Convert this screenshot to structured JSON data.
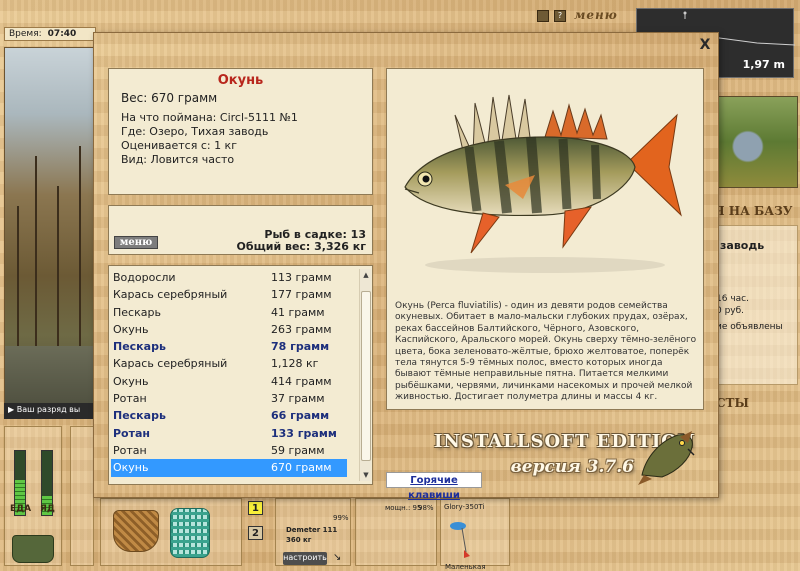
{
  "background": {
    "time_label": "Время:",
    "time_value": "07:40",
    "rank_text": "Ваш разряд вы",
    "gauge_left_label": "ЕДА",
    "gauge_right_label": "ЯД",
    "gauge_left_level": 0.55,
    "gauge_right_level": 0.3,
    "menu_word": "меню",
    "depth_value": "1,97 m",
    "to_base_text": "я на базу",
    "location_text": "заводь",
    "time_hours_text": "16 час.",
    "price_text": "0 руб.",
    "ads_text": "ие объявлены",
    "lower_text": "сты",
    "slot_numbers": [
      "1",
      "2"
    ],
    "percent_1": "99%",
    "reel_name": "Demeter 111",
    "reel_length": "360 кг",
    "setup_button": "настроить",
    "power_label": "мощн.: 95",
    "percent_2": "98%",
    "rod_name": "Glory-350Ti",
    "lure_name": "Маленькая"
  },
  "dialog": {
    "close_symbol": "X",
    "fish": {
      "name": "Окунь",
      "weight_line": "Вес: 670 грамм",
      "caught_on": "На что поймана: Circl-5111 №1",
      "where": "Где: Озеро, Тихая заводь",
      "rated_from": "Оценивается с: 1 кг",
      "kind": "Вид: Ловится часто",
      "description": "Окунь (Perca fluviatilis) - один из девяти родов семейства окуневых. Обитает в мало-мальски глубоких прудах, озёрах, реках бассейнов Балтийского, Чёрного, Азовского, Каспийского, Аральского морей. Окунь сверху тёмно-зелёного цвета, бока зеленовато-жёлтые, брюхо желтоватое, поперёк тела тянутся 5-9 тёмных полос, вместо которых иногда бывают тёмные неправильные пятна. Питается мелкими рыбёшками, червями, личинками насекомых и прочей мелкой живностью. Достигает полуметра длины и массы 4 кг."
    },
    "keepnet": {
      "menu_label": "меню",
      "count_line": "Рыб в садке: 13",
      "total_line": "Общий вес: 3,326 кг"
    },
    "catch_list": [
      {
        "name": "Водоросли",
        "weight": "113 грамм",
        "style": "normal"
      },
      {
        "name": "Карась серебряный",
        "weight": "177 грамм",
        "style": "normal"
      },
      {
        "name": "Пескарь",
        "weight": "41 грамм",
        "style": "normal"
      },
      {
        "name": "Окунь",
        "weight": "263 грамм",
        "style": "normal"
      },
      {
        "name": "Пескарь",
        "weight": "78 грамм",
        "style": "bold"
      },
      {
        "name": "Карась серебряный",
        "weight": "1,128 кг",
        "style": "normal"
      },
      {
        "name": "Окунь",
        "weight": "414 грамм",
        "style": "normal"
      },
      {
        "name": "Ротан",
        "weight": "37 грамм",
        "style": "normal"
      },
      {
        "name": "Пескарь",
        "weight": "66 грамм",
        "style": "bold"
      },
      {
        "name": "Ротан",
        "weight": "133 грамм",
        "style": "bold"
      },
      {
        "name": "Ротан",
        "weight": "59 грамм",
        "style": "normal"
      },
      {
        "name": "Окунь",
        "weight": "670 грамм",
        "style": "selected"
      }
    ],
    "brand": "INSTALLSOFT EDITION",
    "version": "версия 3.7.6",
    "hotkeys_label": "Горячие клавиши"
  }
}
